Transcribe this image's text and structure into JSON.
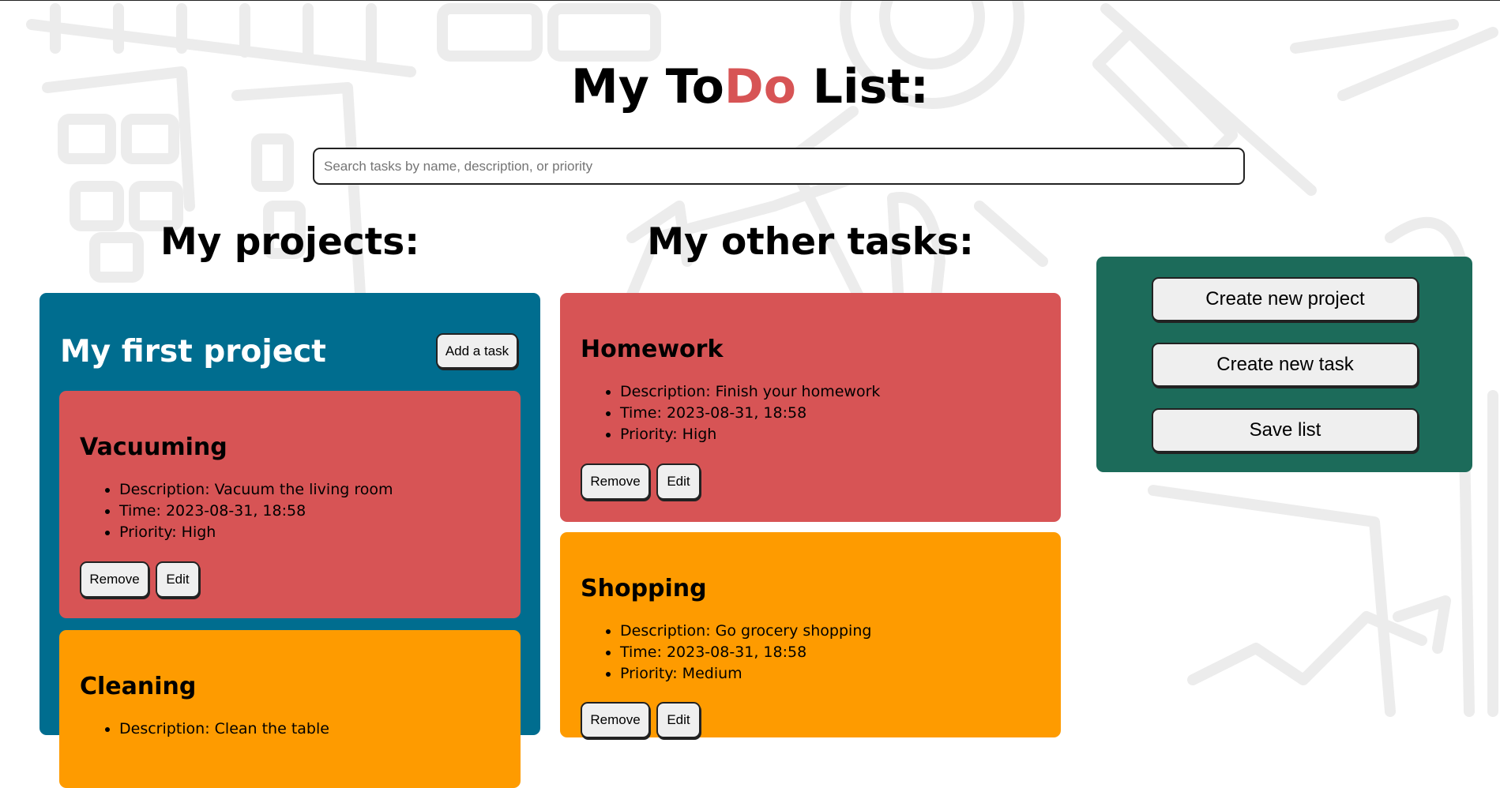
{
  "title": {
    "prefix": "My To",
    "accent": "Do",
    "suffix": " List:"
  },
  "search": {
    "placeholder": "Search tasks by name, description, or priority",
    "value": ""
  },
  "projects_heading": "My projects:",
  "other_tasks_heading": "My other tasks:",
  "colors": {
    "accent": "#d75455",
    "project": "#006d8f",
    "high": "#d75455",
    "medium": "#fe9b00",
    "panel": "#1c6b5a"
  },
  "project": {
    "title": "My first project",
    "add_task_label": "Add a task",
    "tasks": [
      {
        "name": "Vacuuming",
        "description": "Description: Vacuum the living room",
        "time": "Time: 2023-08-31, 18:58",
        "priority": "Priority: High",
        "remove_label": "Remove",
        "edit_label": "Edit"
      },
      {
        "name": "Cleaning",
        "description": "Description: Clean the table"
      }
    ]
  },
  "other_tasks": [
    {
      "name": "Homework",
      "description": "Description: Finish your homework",
      "time": "Time: 2023-08-31, 18:58",
      "priority": "Priority: High",
      "remove_label": "Remove",
      "edit_label": "Edit"
    },
    {
      "name": "Shopping",
      "description": "Description: Go grocery shopping",
      "time": "Time: 2023-08-31, 18:58",
      "priority": "Priority: Medium",
      "remove_label": "Remove",
      "edit_label": "Edit"
    }
  ],
  "actions_panel": {
    "create_project": "Create new project",
    "create_task": "Create new task",
    "save_list": "Save list"
  }
}
